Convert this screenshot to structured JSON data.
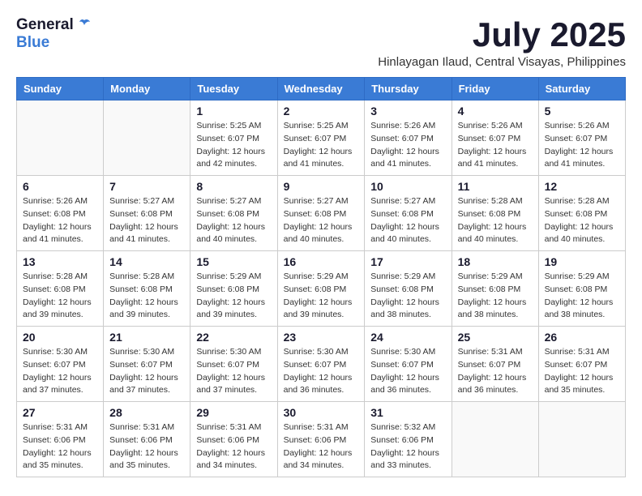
{
  "logo": {
    "text_general": "General",
    "text_blue": "Blue"
  },
  "title": {
    "month_year": "July 2025",
    "location": "Hinlayagan Ilaud, Central Visayas, Philippines"
  },
  "weekdays": [
    "Sunday",
    "Monday",
    "Tuesday",
    "Wednesday",
    "Thursday",
    "Friday",
    "Saturday"
  ],
  "weeks": [
    [
      {
        "day": "",
        "detail": ""
      },
      {
        "day": "",
        "detail": ""
      },
      {
        "day": "1",
        "detail": "Sunrise: 5:25 AM\nSunset: 6:07 PM\nDaylight: 12 hours\nand 42 minutes."
      },
      {
        "day": "2",
        "detail": "Sunrise: 5:25 AM\nSunset: 6:07 PM\nDaylight: 12 hours\nand 41 minutes."
      },
      {
        "day": "3",
        "detail": "Sunrise: 5:26 AM\nSunset: 6:07 PM\nDaylight: 12 hours\nand 41 minutes."
      },
      {
        "day": "4",
        "detail": "Sunrise: 5:26 AM\nSunset: 6:07 PM\nDaylight: 12 hours\nand 41 minutes."
      },
      {
        "day": "5",
        "detail": "Sunrise: 5:26 AM\nSunset: 6:07 PM\nDaylight: 12 hours\nand 41 minutes."
      }
    ],
    [
      {
        "day": "6",
        "detail": "Sunrise: 5:26 AM\nSunset: 6:08 PM\nDaylight: 12 hours\nand 41 minutes."
      },
      {
        "day": "7",
        "detail": "Sunrise: 5:27 AM\nSunset: 6:08 PM\nDaylight: 12 hours\nand 41 minutes."
      },
      {
        "day": "8",
        "detail": "Sunrise: 5:27 AM\nSunset: 6:08 PM\nDaylight: 12 hours\nand 40 minutes."
      },
      {
        "day": "9",
        "detail": "Sunrise: 5:27 AM\nSunset: 6:08 PM\nDaylight: 12 hours\nand 40 minutes."
      },
      {
        "day": "10",
        "detail": "Sunrise: 5:27 AM\nSunset: 6:08 PM\nDaylight: 12 hours\nand 40 minutes."
      },
      {
        "day": "11",
        "detail": "Sunrise: 5:28 AM\nSunset: 6:08 PM\nDaylight: 12 hours\nand 40 minutes."
      },
      {
        "day": "12",
        "detail": "Sunrise: 5:28 AM\nSunset: 6:08 PM\nDaylight: 12 hours\nand 40 minutes."
      }
    ],
    [
      {
        "day": "13",
        "detail": "Sunrise: 5:28 AM\nSunset: 6:08 PM\nDaylight: 12 hours\nand 39 minutes."
      },
      {
        "day": "14",
        "detail": "Sunrise: 5:28 AM\nSunset: 6:08 PM\nDaylight: 12 hours\nand 39 minutes."
      },
      {
        "day": "15",
        "detail": "Sunrise: 5:29 AM\nSunset: 6:08 PM\nDaylight: 12 hours\nand 39 minutes."
      },
      {
        "day": "16",
        "detail": "Sunrise: 5:29 AM\nSunset: 6:08 PM\nDaylight: 12 hours\nand 39 minutes."
      },
      {
        "day": "17",
        "detail": "Sunrise: 5:29 AM\nSunset: 6:08 PM\nDaylight: 12 hours\nand 38 minutes."
      },
      {
        "day": "18",
        "detail": "Sunrise: 5:29 AM\nSunset: 6:08 PM\nDaylight: 12 hours\nand 38 minutes."
      },
      {
        "day": "19",
        "detail": "Sunrise: 5:29 AM\nSunset: 6:08 PM\nDaylight: 12 hours\nand 38 minutes."
      }
    ],
    [
      {
        "day": "20",
        "detail": "Sunrise: 5:30 AM\nSunset: 6:07 PM\nDaylight: 12 hours\nand 37 minutes."
      },
      {
        "day": "21",
        "detail": "Sunrise: 5:30 AM\nSunset: 6:07 PM\nDaylight: 12 hours\nand 37 minutes."
      },
      {
        "day": "22",
        "detail": "Sunrise: 5:30 AM\nSunset: 6:07 PM\nDaylight: 12 hours\nand 37 minutes."
      },
      {
        "day": "23",
        "detail": "Sunrise: 5:30 AM\nSunset: 6:07 PM\nDaylight: 12 hours\nand 36 minutes."
      },
      {
        "day": "24",
        "detail": "Sunrise: 5:30 AM\nSunset: 6:07 PM\nDaylight: 12 hours\nand 36 minutes."
      },
      {
        "day": "25",
        "detail": "Sunrise: 5:31 AM\nSunset: 6:07 PM\nDaylight: 12 hours\nand 36 minutes."
      },
      {
        "day": "26",
        "detail": "Sunrise: 5:31 AM\nSunset: 6:07 PM\nDaylight: 12 hours\nand 35 minutes."
      }
    ],
    [
      {
        "day": "27",
        "detail": "Sunrise: 5:31 AM\nSunset: 6:06 PM\nDaylight: 12 hours\nand 35 minutes."
      },
      {
        "day": "28",
        "detail": "Sunrise: 5:31 AM\nSunset: 6:06 PM\nDaylight: 12 hours\nand 35 minutes."
      },
      {
        "day": "29",
        "detail": "Sunrise: 5:31 AM\nSunset: 6:06 PM\nDaylight: 12 hours\nand 34 minutes."
      },
      {
        "day": "30",
        "detail": "Sunrise: 5:31 AM\nSunset: 6:06 PM\nDaylight: 12 hours\nand 34 minutes."
      },
      {
        "day": "31",
        "detail": "Sunrise: 5:32 AM\nSunset: 6:06 PM\nDaylight: 12 hours\nand 33 minutes."
      },
      {
        "day": "",
        "detail": ""
      },
      {
        "day": "",
        "detail": ""
      }
    ]
  ]
}
